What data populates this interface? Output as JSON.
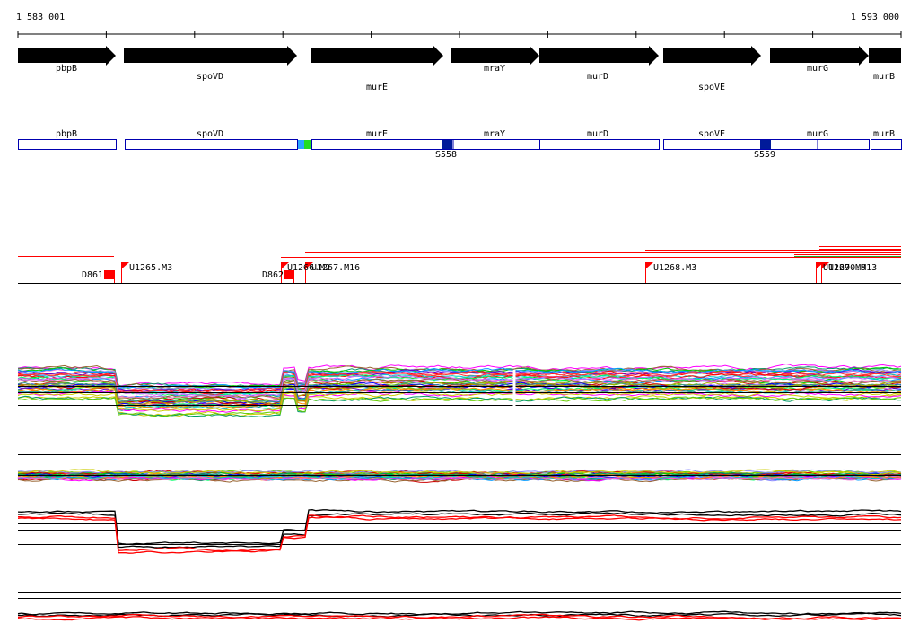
{
  "coordinates": {
    "start": "1 583 001",
    "end": "1 593 000"
  },
  "genes": [
    {
      "name": "pbpB",
      "start": 20,
      "end": 129,
      "label_row": 0
    },
    {
      "name": "spoVD",
      "start": 138,
      "end": 331,
      "label_row": 1
    },
    {
      "name": "murE",
      "start": 346,
      "end": 494,
      "label_row": 2
    },
    {
      "name": "mraY",
      "start": 503,
      "end": 601,
      "label_row": 0
    },
    {
      "name": "murD",
      "start": 601,
      "end": 734,
      "label_row": 1
    },
    {
      "name": "spoVE",
      "start": 739,
      "end": 848,
      "label_row": 2
    },
    {
      "name": "murG",
      "start": 858,
      "end": 968,
      "label_row": 0
    },
    {
      "name": "murB",
      "start": 968,
      "end": 1004,
      "label_row": 1
    }
  ],
  "gene_boxes": [
    {
      "name": "pbpB"
    },
    {
      "name": "spoVD"
    },
    {
      "name": "murE"
    },
    {
      "name": "mraY"
    },
    {
      "name": "murD"
    },
    {
      "name": "spoVE"
    },
    {
      "name": "murG"
    },
    {
      "name": "murB"
    }
  ],
  "markers": [
    {
      "name": "S558",
      "color": "#001a99"
    },
    {
      "name": "S559",
      "color": "#001a99"
    }
  ],
  "features": [
    {
      "label": "D861",
      "flag": "block"
    },
    {
      "label": "U1265.M3",
      "flag": "flag"
    },
    {
      "label": "D862",
      "flag": "block"
    },
    {
      "label": "U1266.M2",
      "flag": "flag"
    },
    {
      "label": "U1267.M16",
      "flag": "flag"
    },
    {
      "label": "U1268.M3",
      "flag": "flag"
    },
    {
      "label": "U1269.M9",
      "flag": "flag"
    },
    {
      "label": "U1270.M13",
      "flag": "flag"
    }
  ],
  "colors": {
    "gene_arrow": "#000000",
    "gene_box_border": "#0000b0",
    "feature_red": "#ff0000",
    "reference_line": "#000000",
    "highlight_cyan": "#2aa6ff",
    "highlight_green": "#22dd22"
  }
}
